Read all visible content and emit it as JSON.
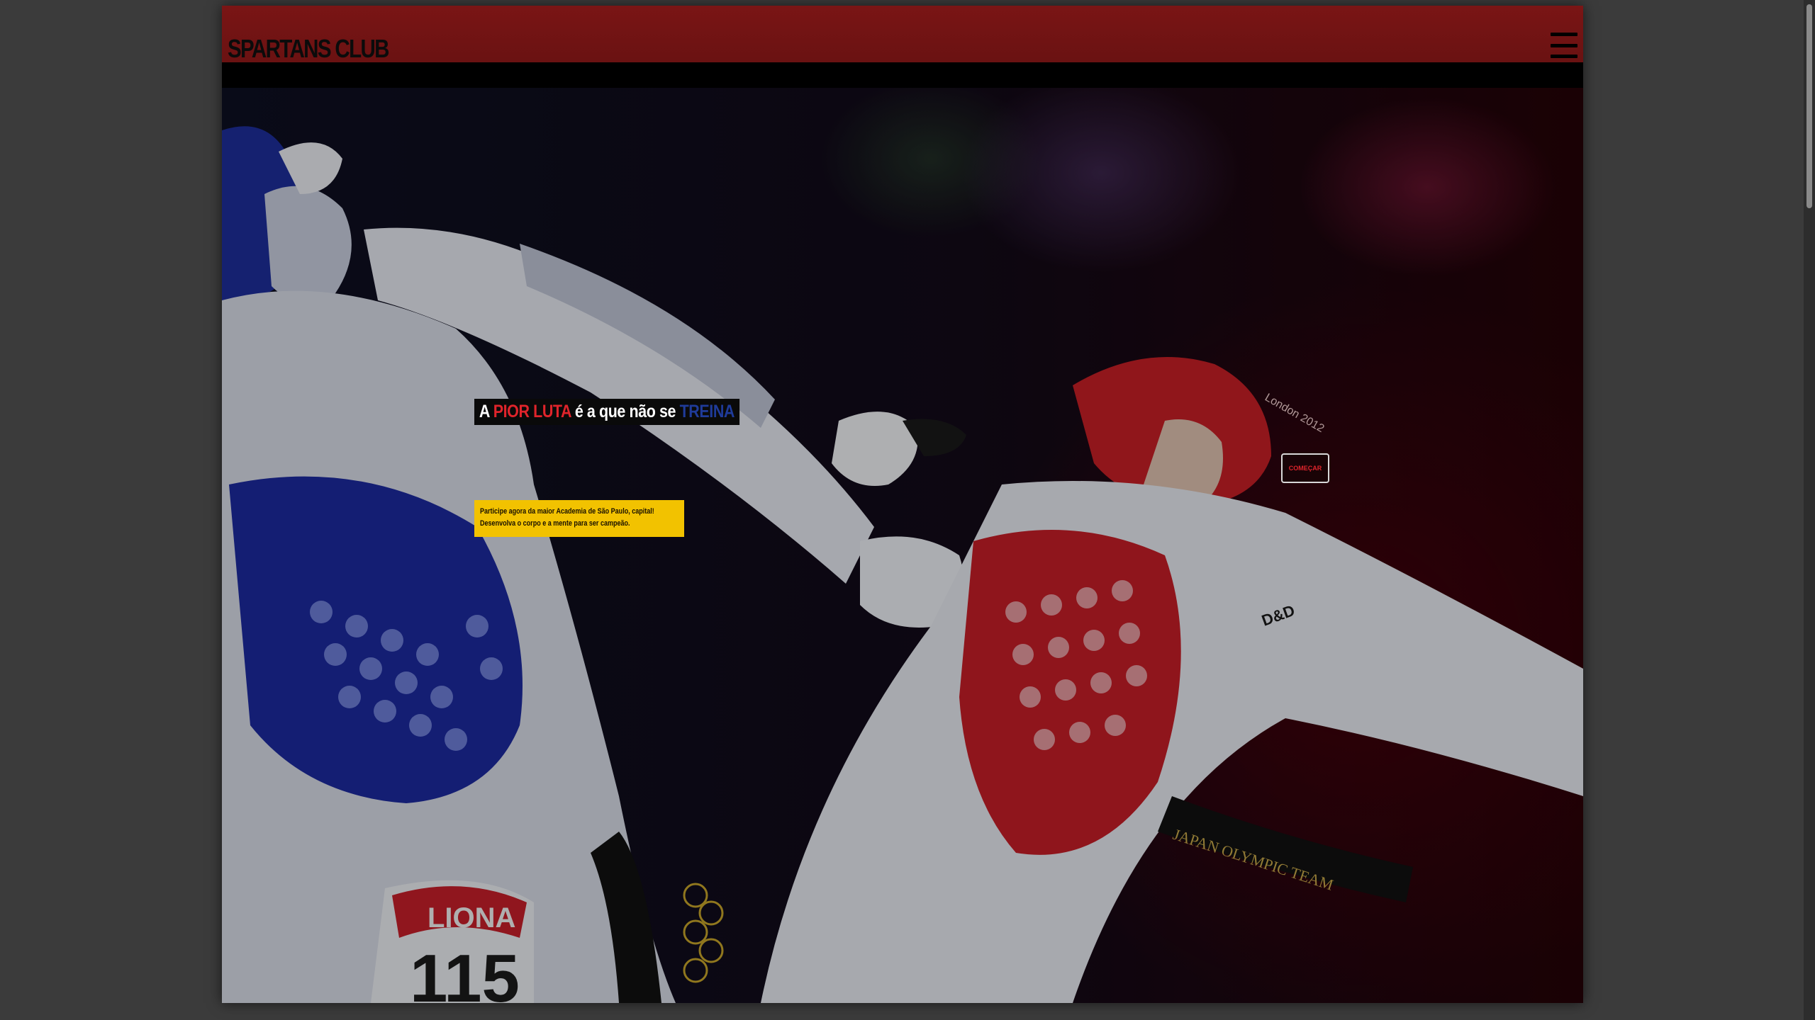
{
  "navbar": {
    "brand": "SPARTANS CLUB",
    "menu_icon": "hamburger-menu-icon"
  },
  "hero": {
    "headline": {
      "part1": "A ",
      "part2_red": "PIOR LUTA",
      "part3": " é a que não se ",
      "part4_blue": "TREINA"
    },
    "subtitle": {
      "line1": "Participe agora da maior Academia de São Paulo, capital!",
      "line2": "Desenvolva o corpo e a mente para ser campeão."
    },
    "cta_label": "COMEÇAR",
    "photo_text": {
      "jersey_name": "LIONA",
      "jersey_number": "115",
      "belt_text": "JAPAN OLYMPIC TEAM",
      "helmet_text": "London 2012",
      "brand_mark": "D&D"
    }
  },
  "colors": {
    "navbar": "#6a1212",
    "accent_red": "#e0242b",
    "accent_blue": "#1f3b9a",
    "subtitle_bg": "#f2c200"
  }
}
